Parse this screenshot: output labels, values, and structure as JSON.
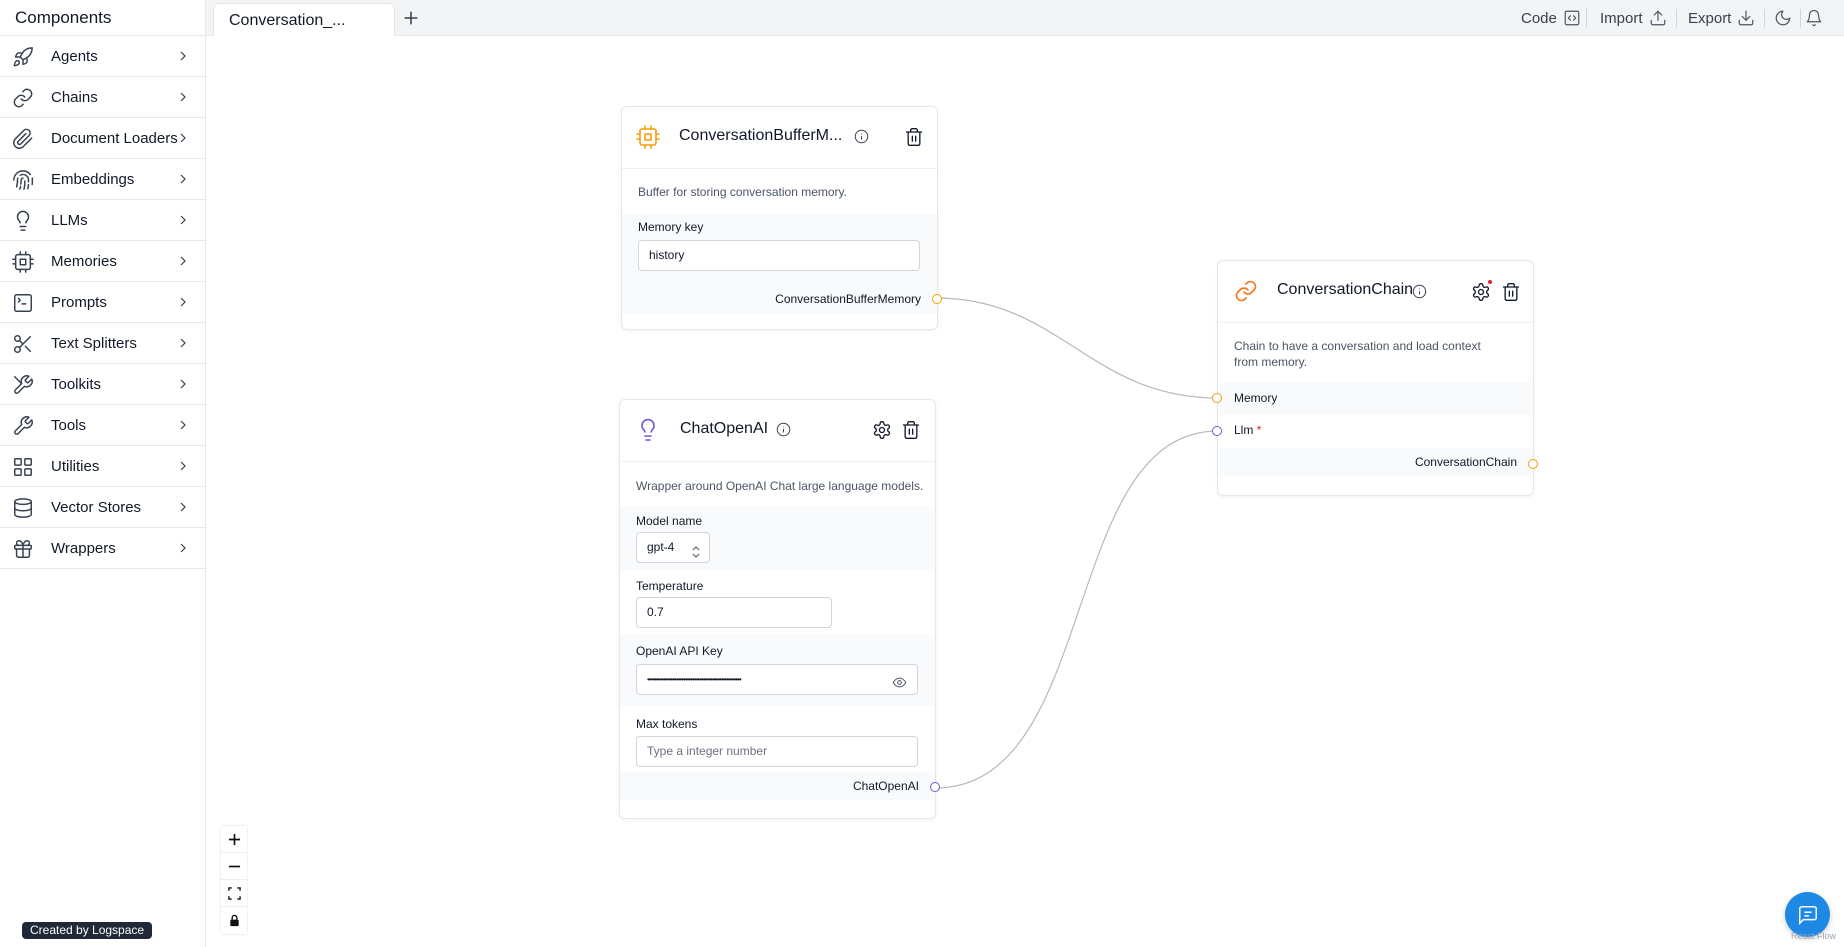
{
  "sidebar": {
    "title": "Components",
    "items": [
      {
        "label": "Agents",
        "icon": "rocket-icon"
      },
      {
        "label": "Chains",
        "icon": "link-icon"
      },
      {
        "label": "Document Loaders",
        "icon": "paperclip-icon"
      },
      {
        "label": "Embeddings",
        "icon": "fingerprint-icon"
      },
      {
        "label": "LLMs",
        "icon": "lightbulb-icon"
      },
      {
        "label": "Memories",
        "icon": "cpu-icon"
      },
      {
        "label": "Prompts",
        "icon": "terminal-icon"
      },
      {
        "label": "Text Splitters",
        "icon": "scissors-icon"
      },
      {
        "label": "Toolkits",
        "icon": "tools-icon"
      },
      {
        "label": "Tools",
        "icon": "wrench-icon"
      },
      {
        "label": "Utilities",
        "icon": "grid-icon"
      },
      {
        "label": "Vector Stores",
        "icon": "database-icon"
      },
      {
        "label": "Wrappers",
        "icon": "gift-icon"
      }
    ],
    "credit": "Created by Logspace"
  },
  "topbar": {
    "tab_label": "Conversation_...",
    "code_label": "Code",
    "import_label": "Import",
    "export_label": "Export"
  },
  "nodes": {
    "memory": {
      "title": "ConversationBufferM...",
      "description": "Buffer for storing conversation memory.",
      "field_label": "Memory key",
      "field_value": "history",
      "output_label": "ConversationBufferMemory"
    },
    "chain": {
      "title": "ConversationChain",
      "description": "Chain to have a conversation and load context from memory.",
      "input_memory": "Memory",
      "input_llm": "Llm",
      "required_mark": "*",
      "output_label": "ConversationChain"
    },
    "llm": {
      "title": "ChatOpenAI",
      "description": "Wrapper around OpenAI Chat large language models.",
      "model_label": "Model name",
      "model_value": "gpt-4",
      "temp_label": "Temperature",
      "temp_value": "0.7",
      "key_label": "OpenAI API Key",
      "key_value": "••••••••••••••••••••••••••••••••••••••••••••••••••••",
      "max_label": "Max tokens",
      "max_placeholder": "Type a integer number",
      "output_label": "ChatOpenAI"
    }
  },
  "attribution": "React Flow",
  "colors": {
    "memory_handle": "#f59e0b",
    "llm_handle": "#6d5bd0",
    "accent": "#1e88e5"
  }
}
